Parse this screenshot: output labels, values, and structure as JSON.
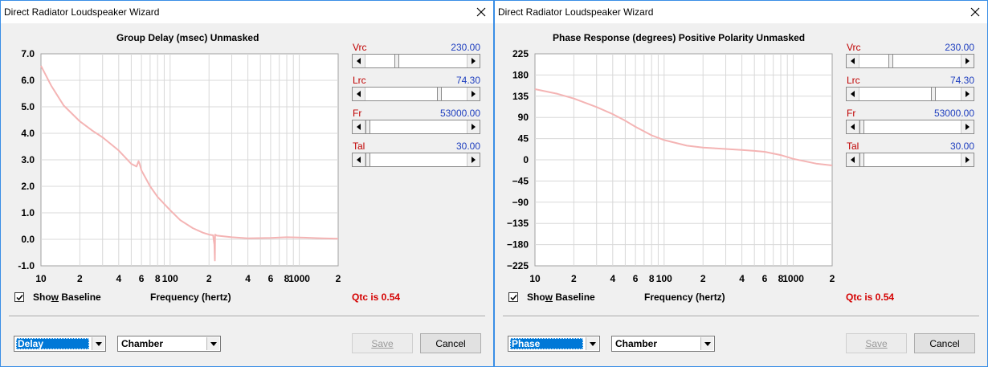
{
  "windows": [
    {
      "title": "Direct Radiator Loudspeaker Wizard",
      "chart_title": "Group Delay (msec)   Unmasked",
      "sliders": [
        {
          "label": "Vrc",
          "value": "230.00",
          "thumb_frac": 0.3
        },
        {
          "label": "Lrc",
          "value": "74.30",
          "thumb_frac": 0.74
        },
        {
          "label": "Fr",
          "value": "53000.00",
          "thumb_frac": 0.0
        },
        {
          "label": "Tal",
          "value": "30.00",
          "thumb_frac": 0.0
        }
      ],
      "show_baseline_pre": "Sho",
      "show_baseline_ul": "w",
      "show_baseline_post": " Baseline",
      "show_baseline_checked": true,
      "frequency_label": "Frequency (hertz)",
      "qtc": "Qtc is 0.54",
      "combo1": "Delay",
      "combo2": "Chamber",
      "save_label": "Save",
      "cancel_label": "Cancel"
    },
    {
      "title": "Direct Radiator Loudspeaker Wizard",
      "chart_title": "Phase Response (degrees)   Positive Polarity   Unmasked",
      "sliders": [
        {
          "label": "Vrc",
          "value": "230.00",
          "thumb_frac": 0.3
        },
        {
          "label": "Lrc",
          "value": "74.30",
          "thumb_frac": 0.74
        },
        {
          "label": "Fr",
          "value": "53000.00",
          "thumb_frac": 0.0
        },
        {
          "label": "Tal",
          "value": "30.00",
          "thumb_frac": 0.0
        }
      ],
      "show_baseline_pre": "Sho",
      "show_baseline_ul": "w",
      "show_baseline_post": " Baseline",
      "show_baseline_checked": true,
      "frequency_label": "Frequency (hertz)",
      "qtc": "Qtc is 0.54",
      "combo1": "Phase",
      "combo2": "Chamber",
      "save_label": "Save",
      "cancel_label": "Cancel"
    }
  ],
  "chart_data": [
    {
      "type": "line",
      "title": "Group Delay (msec)   Unmasked",
      "xlabel": "Frequency (hertz)",
      "ylabel": "",
      "xscale": "log",
      "xlim": [
        10,
        2000
      ],
      "ylim": [
        -1.0,
        7.0
      ],
      "yticks": [
        "7.0",
        "6.0",
        "5.0",
        "4.0",
        "3.0",
        "2.0",
        "1.0",
        "0.0",
        "-1.0"
      ],
      "ytick_values": [
        7,
        6,
        5,
        4,
        3,
        2,
        1,
        0,
        -1
      ],
      "xticks": [
        "10",
        "2",
        "4",
        "6",
        "8",
        "100",
        "2",
        "4",
        "6",
        "8",
        "1000",
        "2"
      ],
      "xtick_values": [
        10,
        20,
        40,
        60,
        80,
        100,
        200,
        400,
        600,
        800,
        1000,
        2000
      ],
      "grid": true,
      "line_color": "#f4b4b4",
      "series": [
        {
          "x": [
            10,
            12,
            15,
            20,
            25,
            30,
            40,
            50,
            55,
            57,
            58,
            60,
            70,
            80,
            100,
            120,
            150,
            180,
            200,
            215,
            220,
            222,
            223,
            230,
            300,
            400,
            600,
            800,
            1000,
            1500,
            2000
          ],
          "values": [
            6.55,
            5.8,
            5.05,
            4.45,
            4.1,
            3.85,
            3.35,
            2.85,
            2.75,
            2.95,
            2.85,
            2.6,
            2.0,
            1.6,
            1.1,
            0.72,
            0.42,
            0.25,
            0.18,
            0.15,
            -0.2,
            -0.8,
            0.18,
            0.14,
            0.08,
            0.04,
            0.05,
            0.08,
            0.07,
            0.04,
            0.02
          ]
        }
      ]
    },
    {
      "type": "line",
      "title": "Phase Response (degrees)   Positive Polarity   Unmasked",
      "xlabel": "Frequency (hertz)",
      "ylabel": "",
      "xscale": "log",
      "xlim": [
        10,
        2000
      ],
      "ylim": [
        -225,
        225
      ],
      "yticks": [
        "225",
        "180",
        "135",
        "90",
        "45",
        "0",
        "−45",
        "−90",
        "−135",
        "−180",
        "−225"
      ],
      "ytick_values": [
        225,
        180,
        135,
        90,
        45,
        0,
        -45,
        -90,
        -135,
        -180,
        -225
      ],
      "xticks": [
        "10",
        "2",
        "4",
        "6",
        "8",
        "100",
        "2",
        "4",
        "6",
        "8",
        "1000",
        "2"
      ],
      "xtick_values": [
        10,
        20,
        40,
        60,
        80,
        100,
        200,
        400,
        600,
        800,
        1000,
        2000
      ],
      "grid": true,
      "line_color": "#f4b4b4",
      "series": [
        {
          "x": [
            10,
            15,
            20,
            30,
            40,
            50,
            60,
            80,
            100,
            150,
            200,
            300,
            400,
            500,
            600,
            800,
            1000,
            1500,
            2000
          ],
          "values": [
            150,
            140,
            130,
            112,
            97,
            83,
            70,
            52,
            42,
            30,
            26,
            23,
            21,
            19,
            17,
            10,
            2,
            -8,
            -12
          ]
        }
      ]
    }
  ]
}
